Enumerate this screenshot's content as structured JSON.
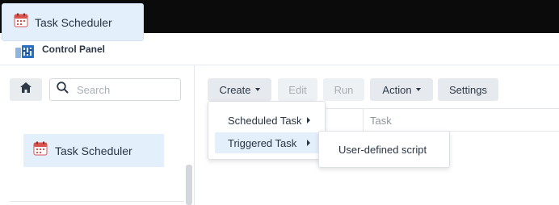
{
  "taskbar": {
    "tab_label": "Task Scheduler",
    "tab_icon": "calendar-icon"
  },
  "control_panel": {
    "title": "Control Panel",
    "icon": "control-panel-icon"
  },
  "sidebar": {
    "home_icon": "home-icon",
    "search": {
      "placeholder": "Search",
      "value": ""
    },
    "items": [
      {
        "label": "Task Scheduler",
        "icon": "calendar-icon",
        "selected": true
      }
    ]
  },
  "toolbar": {
    "create_label": "Create",
    "edit_label": "Edit",
    "run_label": "Run",
    "action_label": "Action",
    "settings_label": "Settings"
  },
  "grid": {
    "columns": [
      "",
      "Task"
    ]
  },
  "create_menu": {
    "items": [
      {
        "label": "Scheduled Task",
        "has_submenu": true
      },
      {
        "label": "Triggered Task",
        "has_submenu": true,
        "active": true
      }
    ]
  },
  "triggered_submenu": {
    "items": [
      {
        "label": "User-defined script"
      }
    ]
  },
  "colors": {
    "accent_bg": "#e3effb",
    "topbar": "#0b0b0c",
    "button_bg": "#e6eaee",
    "calendar_red": "#d9534f"
  }
}
